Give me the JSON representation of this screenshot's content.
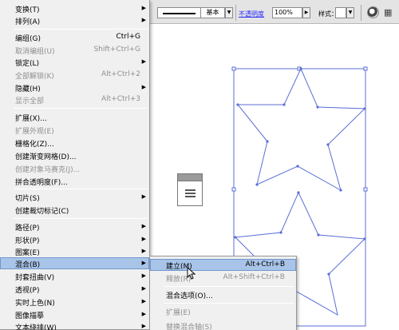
{
  "toolbar": {
    "stroke_style": "基本",
    "opacity_label": "不透明度",
    "opacity_value": "100%",
    "style_label": "样式：",
    "dropdown_glyph": "▼",
    "arrow_glyph": "▶",
    "grid_glyph": "▦"
  },
  "main_menu": {
    "items": [
      {
        "label": "变换(T)",
        "shortcut": "",
        "submenu": true,
        "disabled": false
      },
      {
        "label": "排列(A)",
        "shortcut": "",
        "submenu": true,
        "disabled": false
      },
      {
        "label": "编组(G)",
        "shortcut": "Ctrl+G",
        "submenu": false,
        "disabled": false
      },
      {
        "label": "取消编组(U)",
        "shortcut": "Shift+Ctrl+G",
        "submenu": false,
        "disabled": true
      },
      {
        "label": "锁定(L)",
        "shortcut": "",
        "submenu": true,
        "disabled": false
      },
      {
        "label": "全部解锁(K)",
        "shortcut": "Alt+Ctrl+2",
        "submenu": false,
        "disabled": true
      },
      {
        "label": "隐藏(H)",
        "shortcut": "",
        "submenu": true,
        "disabled": false
      },
      {
        "label": "显示全部",
        "shortcut": "Alt+Ctrl+3",
        "submenu": false,
        "disabled": true
      },
      {
        "label": "扩展(X)...",
        "shortcut": "",
        "submenu": false,
        "disabled": false
      },
      {
        "label": "扩展外观(E)",
        "shortcut": "",
        "submenu": false,
        "disabled": true
      },
      {
        "label": "栅格化(Z)...",
        "shortcut": "",
        "submenu": false,
        "disabled": false
      },
      {
        "label": "创建渐变网格(D)...",
        "shortcut": "",
        "submenu": false,
        "disabled": false
      },
      {
        "label": "创建对象马赛克(J)...",
        "shortcut": "",
        "submenu": false,
        "disabled": true
      },
      {
        "label": "拼合透明度(F)...",
        "shortcut": "",
        "submenu": false,
        "disabled": false
      },
      {
        "label": "切片(S)",
        "shortcut": "",
        "submenu": true,
        "disabled": false
      },
      {
        "label": "创建裁切标记(C)",
        "shortcut": "",
        "submenu": false,
        "disabled": false
      },
      {
        "label": "路径(P)",
        "shortcut": "",
        "submenu": true,
        "disabled": false
      },
      {
        "label": "形状(P)",
        "shortcut": "",
        "submenu": true,
        "disabled": false
      },
      {
        "label": "图案(E)",
        "shortcut": "",
        "submenu": true,
        "disabled": false
      },
      {
        "label": "混合(B)",
        "shortcut": "",
        "submenu": true,
        "disabled": false,
        "highlighted": true
      },
      {
        "label": "封套扭曲(V)",
        "shortcut": "",
        "submenu": true,
        "disabled": false
      },
      {
        "label": "透视(P)",
        "shortcut": "",
        "submenu": true,
        "disabled": false
      },
      {
        "label": "实时上色(N)",
        "shortcut": "",
        "submenu": true,
        "disabled": false
      },
      {
        "label": "图像描摹",
        "shortcut": "",
        "submenu": true,
        "disabled": false
      },
      {
        "label": "文本绕排(W)",
        "shortcut": "",
        "submenu": true,
        "disabled": false
      }
    ]
  },
  "sub_menu": {
    "items": [
      {
        "label": "建立(M)",
        "shortcut": "Alt+Ctrl+B",
        "disabled": false,
        "highlighted": true
      },
      {
        "label": "释放(R)",
        "shortcut": "Alt+Shift+Ctrl+B",
        "disabled": true
      },
      {
        "label": "混合选项(O)...",
        "shortcut": "",
        "disabled": false
      },
      {
        "label": "扩展(E)",
        "shortcut": "",
        "disabled": true
      },
      {
        "label": "替换混合轴(S)",
        "shortcut": "",
        "disabled": true
      }
    ]
  },
  "colors": {
    "selection": "#5b6ed6",
    "menu_bg": "#f0f0f0",
    "highlight": "#a8c4e8",
    "disabled_text": "#8f8f8f"
  }
}
